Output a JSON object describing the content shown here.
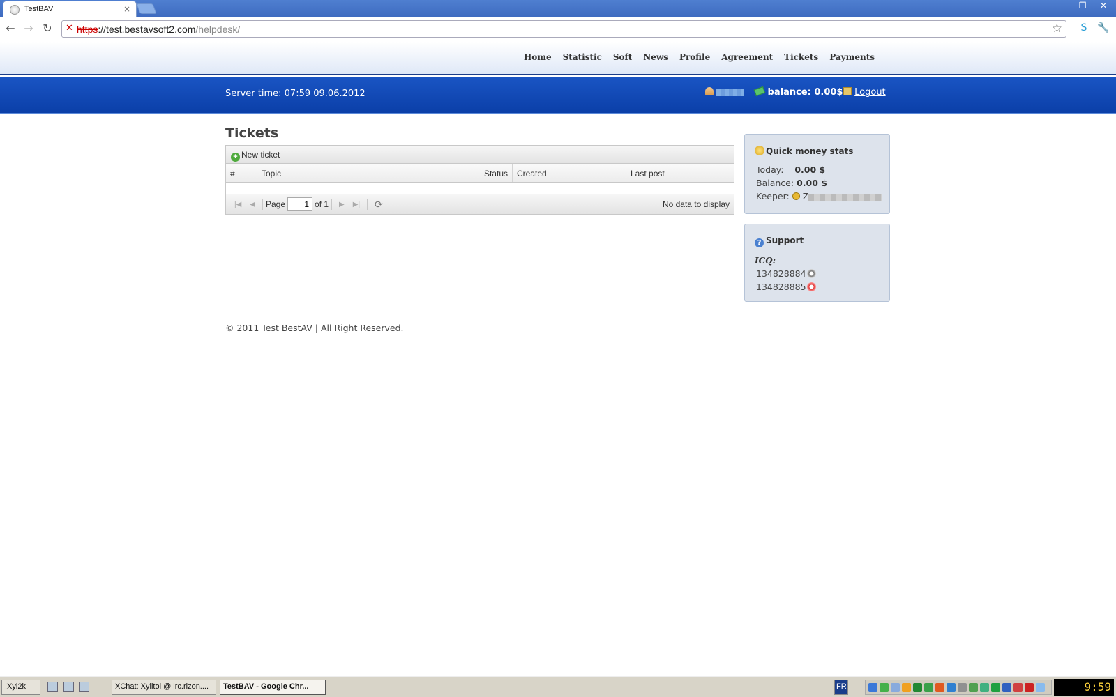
{
  "browser": {
    "tab_title": "TestBAV",
    "tab_close": "×",
    "url_scheme": "https",
    "url_host": "://test.bestavsoft2.com",
    "url_path": "/helpdesk/",
    "window_buttons": [
      "‒",
      "❐",
      "✕"
    ]
  },
  "nav": {
    "items": [
      "Home",
      "Statistic",
      "Soft",
      "News",
      "Profile",
      "Agreement",
      "Tickets",
      "Payments"
    ]
  },
  "bar": {
    "server_time": "Server time: 07:59 09.06.2012",
    "balance": "balance: 0.00$",
    "logout": "Logout"
  },
  "tickets": {
    "title": "Tickets",
    "new_ticket": "New ticket",
    "columns": [
      "#",
      "Topic",
      "Status",
      "Created",
      "Last post"
    ],
    "pager": {
      "page_label": "Page",
      "page_value": "1",
      "of_label": "of 1",
      "no_data": "No data to display"
    }
  },
  "money_panel": {
    "title": "Quick money stats",
    "today_label": "Today:",
    "today_value": "0.00 $",
    "balance_label": "Balance:",
    "balance_value": "0.00 $",
    "keeper_label": "Keeper:",
    "keeper_prefix": "Z"
  },
  "support_panel": {
    "title": "Support",
    "icq_label": "ICQ:",
    "icq_numbers": [
      "134828884",
      "134828885"
    ]
  },
  "footer": {
    "copyright": "© 2011 Test BestAV | All Right Reserved."
  },
  "taskbar": {
    "start": "!Xyl2k",
    "task_xchat": "XChat: Xylitol @ irc.rizon....",
    "task_chrome": "TestBAV - Google Chr...",
    "lang": "FR",
    "clock": "9:59"
  },
  "colors": {
    "header_blue": "#0b3fa8",
    "panel_bg": "#dde3ec",
    "text": "#333333"
  }
}
